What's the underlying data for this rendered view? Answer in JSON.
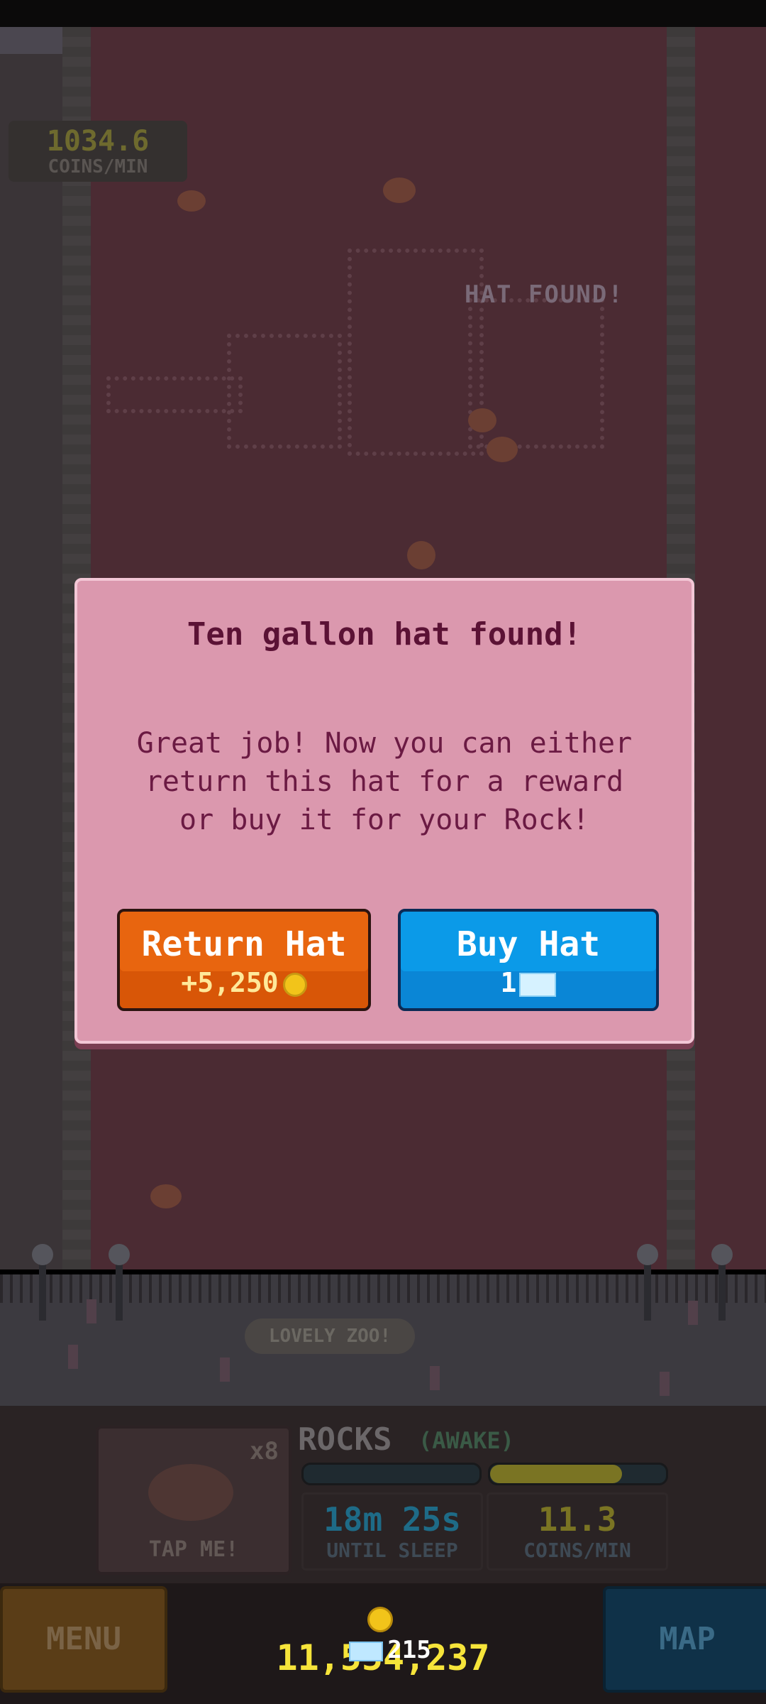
{
  "hud": {
    "rate_value": "1034.6",
    "rate_label": "COINS/MIN",
    "hat_found_banner": "HAT FOUND!",
    "lovely_zoo": "LOVELY ZOO!"
  },
  "dialog": {
    "title": "Ten gallon hat found!",
    "body": "Great job! Now you can either\nreturn this hat for a reward\nor buy it for your Rock!",
    "return_button": {
      "label": "Return Hat",
      "reward": "+5,250"
    },
    "buy_button": {
      "label": "Buy Hat",
      "cost": "1"
    }
  },
  "panel": {
    "tap_card": {
      "multiplier": "x8",
      "label": "TAP ME!"
    },
    "title": "ROCKS",
    "state": "(AWAKE)",
    "sleep_bar_fill": 0.0,
    "progress_bar_fill": 0.75,
    "until_sleep_value": "18m 25s",
    "until_sleep_label": "UNTIL SLEEP",
    "coins_per_min_value": "11.3",
    "coins_per_min_label": "COINS/MIN"
  },
  "bottom": {
    "menu": "MENU",
    "map": "MAP",
    "coins": "11,554,237",
    "gems": "215"
  },
  "colors": {
    "dialog_bg": "#db98ae",
    "title_text": "#5b1235",
    "return_button": "#e8650f",
    "buy_button": "#0b9ae8",
    "coin_text": "#f6e43a"
  }
}
